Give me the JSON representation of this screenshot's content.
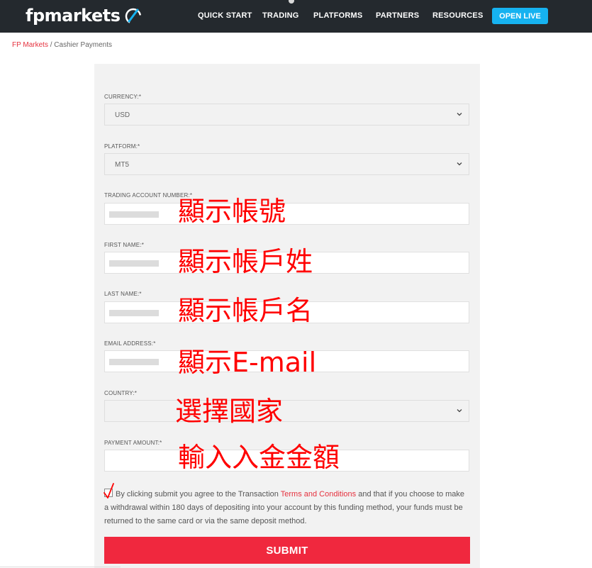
{
  "header": {
    "logo_text": "fpmarkets",
    "nav": [
      "QUICK START",
      "TRADING",
      "PLATFORMS",
      "PARTNERS",
      "RESOURCES"
    ],
    "cta": "OPEN LIVE",
    "colors": {
      "bar": "#24292e",
      "cta": "#16b2f0"
    }
  },
  "breadcrumb": {
    "link": "FP Markets",
    "separator": " / ",
    "current": "Cashier Payments"
  },
  "form": {
    "currency": {
      "label": "CURRENCY:*",
      "value": "USD"
    },
    "platform": {
      "label": "PLATFORM:*",
      "value": "MT5"
    },
    "account_number": {
      "label": "TRADING ACCOUNT NUMBER:*"
    },
    "first_name": {
      "label": "FIRST NAME:*"
    },
    "last_name": {
      "label": "LAST NAME:*"
    },
    "email": {
      "label": "EMAIL ADDRESS:*"
    },
    "country": {
      "label": "COUNTRY:*",
      "value": ""
    },
    "amount": {
      "label": "PAYMENT AMOUNT:*",
      "value": ""
    },
    "terms": {
      "before": "By clicking submit you agree to the Transaction ",
      "link": "Terms and Conditions",
      "after": " and that if you choose to make a withdrawal within 180 days of depositing into your account by this funding method, your funds must be returned to the same card or via the same deposit method."
    },
    "submit": "SUBMIT",
    "submit_color": "#f0283e"
  },
  "annotations": {
    "account": "顯示帳號",
    "first_name": "顯示帳戶姓",
    "last_name": "顯示帳戶名",
    "email": "顯示E-mail",
    "country": "選擇國家",
    "amount": "輸入入金金額",
    "color": "#ff0000"
  }
}
